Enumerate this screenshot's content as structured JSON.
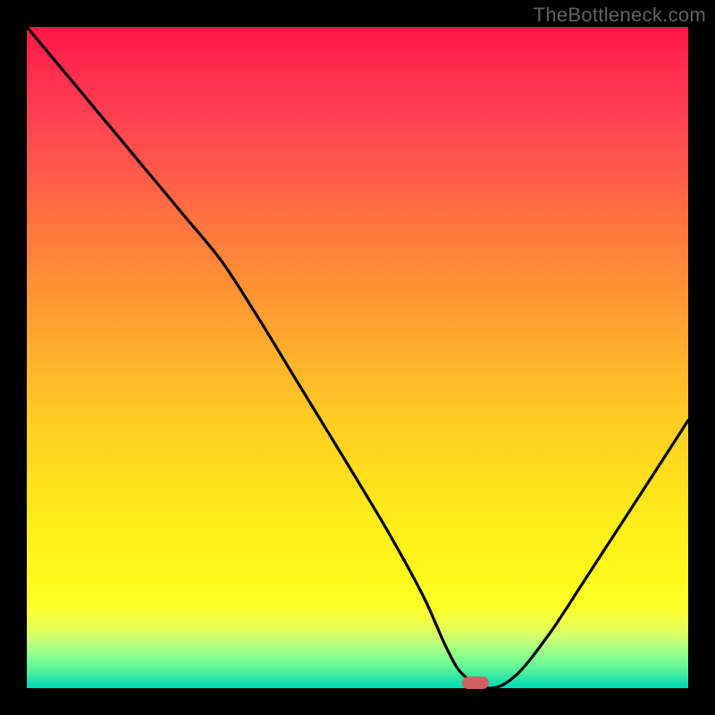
{
  "watermark": "TheBottleneck.com",
  "marker": {
    "x_frac": 0.678,
    "y_frac": 0.992,
    "color": "#d16060"
  },
  "chart_data": {
    "type": "line",
    "title": "",
    "xlabel": "",
    "ylabel": "",
    "xlim": [
      0,
      1
    ],
    "ylim": [
      0,
      1
    ],
    "series": [
      {
        "name": "curve",
        "x": [
          0.0,
          0.06,
          0.12,
          0.18,
          0.24,
          0.295,
          0.35,
          0.4,
          0.45,
          0.5,
          0.55,
          0.6,
          0.635,
          0.66,
          0.7,
          0.74,
          0.79,
          0.84,
          0.89,
          0.94,
          1.0
        ],
        "y": [
          1.0,
          0.928,
          0.856,
          0.784,
          0.712,
          0.645,
          0.56,
          0.478,
          0.396,
          0.314,
          0.23,
          0.138,
          0.06,
          0.02,
          0.0,
          0.02,
          0.082,
          0.158,
          0.235,
          0.312,
          0.405
        ]
      }
    ],
    "annotations": [
      {
        "type": "pill-marker",
        "x": 0.678,
        "y": 0.008,
        "color": "#d16060"
      }
    ]
  }
}
